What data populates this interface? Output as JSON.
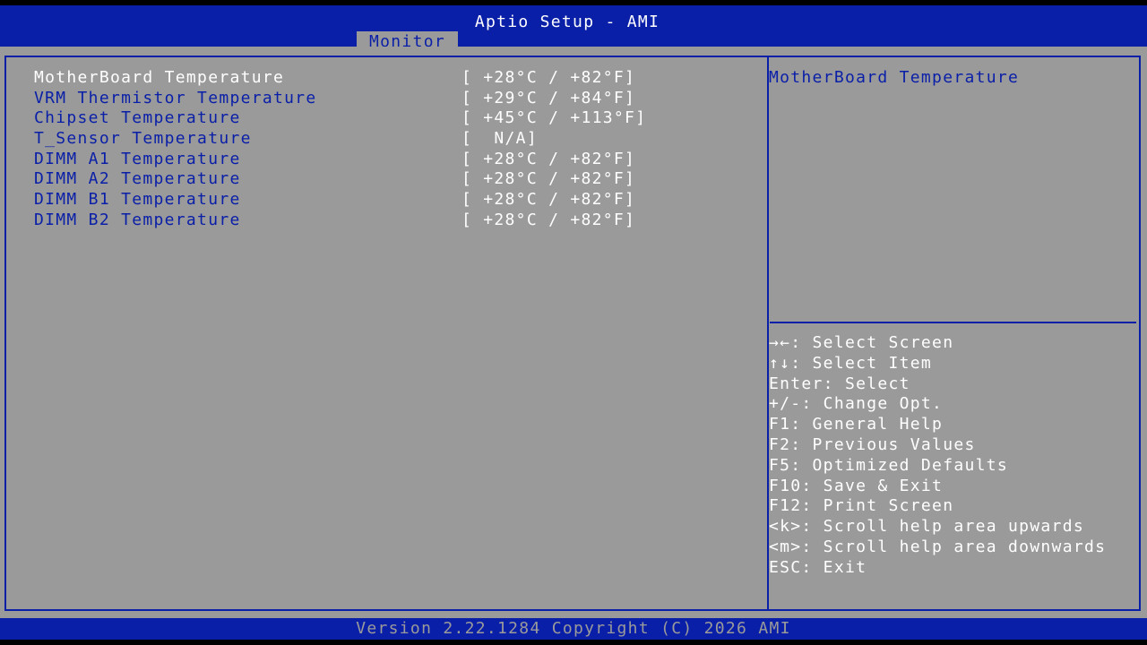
{
  "header": {
    "title": "Aptio Setup - AMI",
    "tabs": [
      {
        "label": "Monitor",
        "active": true
      }
    ]
  },
  "items": [
    {
      "label": "MotherBoard Temperature",
      "value": "[ +28°C / +82°F]",
      "selected": true
    },
    {
      "label": "VRM Thermistor Temperature",
      "value": "[ +29°C / +84°F]",
      "selected": false
    },
    {
      "label": "Chipset Temperature",
      "value": "[ +45°C / +113°F]",
      "selected": false
    },
    {
      "label": "T_Sensor Temperature",
      "value": "[  N/A]",
      "selected": false
    },
    {
      "label": "DIMM A1 Temperature",
      "value": "[ +28°C / +82°F]",
      "selected": false
    },
    {
      "label": "DIMM A2 Temperature",
      "value": "[ +28°C / +82°F]",
      "selected": false
    },
    {
      "label": "DIMM B1 Temperature",
      "value": "[ +28°C / +82°F]",
      "selected": false
    },
    {
      "label": "DIMM B2 Temperature",
      "value": "[ +28°C / +82°F]",
      "selected": false
    }
  ],
  "help": {
    "title": "MotherBoard Temperature",
    "keys": [
      "→←: Select Screen",
      "↑↓: Select Item",
      "Enter: Select",
      "+/-: Change Opt.",
      "F1: General Help",
      "F2: Previous Values",
      "F5: Optimized Defaults",
      "F10: Save & Exit",
      "F12: Print Screen",
      "<k>: Scroll help area upwards",
      "<m>: Scroll help area downwards",
      "ESC: Exit"
    ]
  },
  "footer": {
    "version": "Version 2.22.1284 Copyright (C) 2026 AMI"
  },
  "colors": {
    "bios_blue": "#0a1fa8",
    "panel_gray": "#9a9a9a",
    "highlight_white": "#ffffff"
  }
}
